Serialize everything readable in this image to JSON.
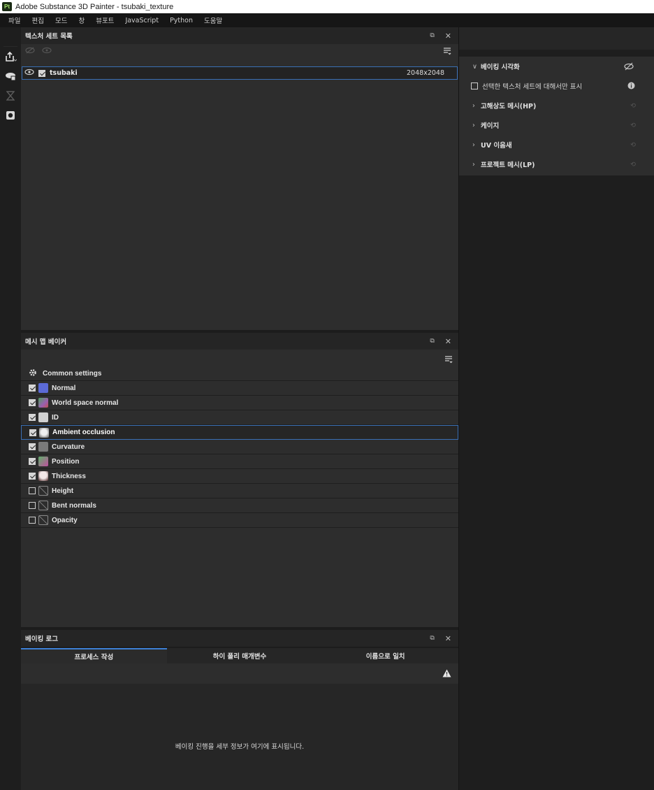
{
  "window": {
    "app_icon": "Pt",
    "title": "Adobe Substance 3D Painter - tsubaki_texture"
  },
  "menu": [
    "파일",
    "편집",
    "모드",
    "창",
    "뷰포트",
    "JavaScript",
    "Python",
    "도움말"
  ],
  "texture_set_panel": {
    "title": "텍스처 세트 목록",
    "rows": [
      {
        "name": "tsubaki",
        "resolution": "2048x2048",
        "visible": true,
        "checked": true
      }
    ]
  },
  "baker_panel": {
    "title": "메시 맵 베이커",
    "common_settings": "Common settings",
    "maps": [
      {
        "label": "Normal",
        "checked": true,
        "thumb": "#5b6ad6",
        "selected": false
      },
      {
        "label": "World space normal",
        "checked": true,
        "thumb": "#9a5fb0",
        "selected": false
      },
      {
        "label": "ID",
        "checked": true,
        "thumb": "#d0d0d0",
        "selected": false
      },
      {
        "label": "Ambient occlusion",
        "checked": true,
        "thumb": "#e8e8e8",
        "selected": true
      },
      {
        "label": "Curvature",
        "checked": true,
        "thumb": "#7a7a7a",
        "selected": false
      },
      {
        "label": "Position",
        "checked": true,
        "thumb": "#5fb06a",
        "selected": false
      },
      {
        "label": "Thickness",
        "checked": true,
        "thumb": "#e0d8d8",
        "selected": false
      },
      {
        "label": "Height",
        "checked": false,
        "thumb": "",
        "selected": false
      },
      {
        "label": "Bent normals",
        "checked": false,
        "thumb": "",
        "selected": false
      },
      {
        "label": "Opacity",
        "checked": false,
        "thumb": "",
        "selected": false
      }
    ]
  },
  "log_panel": {
    "title": "베이킹 로그",
    "tabs": [
      {
        "label": "프로세스 작성",
        "active": true
      },
      {
        "label": "하이 폴리 매개변수",
        "active": false
      },
      {
        "label": "이름으로 일치",
        "active": false
      }
    ],
    "message": "베이킹 진행을 세부 정보가 여기에 표시됩니다."
  },
  "visualization_panel": {
    "header": "베이킹 시각화",
    "checkbox_label": "선택한 텍스처 세트에 대해서만 표시",
    "sections": [
      "고해상도 메시(HP)",
      "케이지",
      "UV 이음새",
      "프로젝트 메시(LP)"
    ]
  }
}
